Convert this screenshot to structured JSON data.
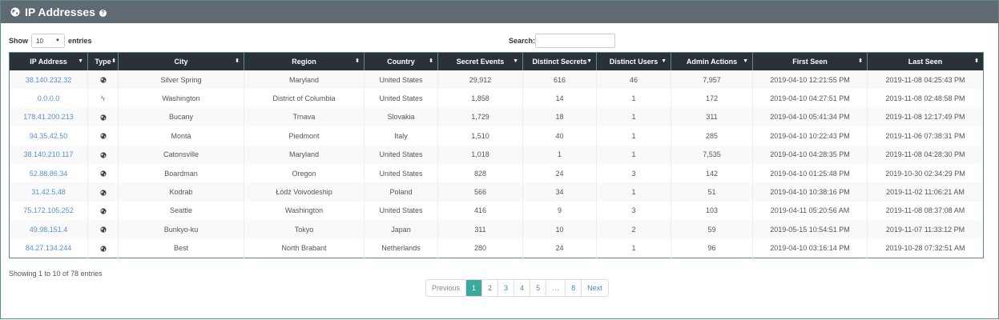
{
  "header": {
    "title": "IP Addresses",
    "help": "?"
  },
  "controls": {
    "show_label": "Show",
    "page_length": "10",
    "entries_label": "entries",
    "search_label": "Search:",
    "search_value": ""
  },
  "columns": [
    "IP Address",
    "Type",
    "City",
    "Region",
    "Country",
    "Secret Events",
    "Distinct Secrets",
    "Distinct Users",
    "Admin Actions",
    "First Seen",
    "Last Seen"
  ],
  "rows": [
    {
      "ip": "38.140.232.32",
      "type": "globe",
      "city": "Silver Spring",
      "region": "Maryland",
      "country": "United States",
      "secret_events": "29,912",
      "distinct_secrets": "616",
      "distinct_users": "46",
      "admin_actions": "7,957",
      "first_seen": "2019-04-10 12:21:55 PM",
      "last_seen": "2019-11-08 04:25:43 PM"
    },
    {
      "ip": "0.0.0.0",
      "type": "bolt",
      "city": "Washington",
      "region": "District of Columbia",
      "country": "United States",
      "secret_events": "1,858",
      "distinct_secrets": "14",
      "distinct_users": "1",
      "admin_actions": "172",
      "first_seen": "2019-04-10 04:27:51 PM",
      "last_seen": "2019-11-08 02:48:58 PM"
    },
    {
      "ip": "178.41.200.213",
      "type": "globe",
      "city": "Bucany",
      "region": "Trnava",
      "country": "Slovakia",
      "secret_events": "1,729",
      "distinct_secrets": "18",
      "distinct_users": "1",
      "admin_actions": "311",
      "first_seen": "2019-04-10 05:41:34 PM",
      "last_seen": "2019-11-08 12:17:49 PM"
    },
    {
      "ip": "94.35.42.50",
      "type": "globe",
      "city": "Montà",
      "region": "Piedmont",
      "country": "Italy",
      "secret_events": "1,510",
      "distinct_secrets": "40",
      "distinct_users": "1",
      "admin_actions": "285",
      "first_seen": "2019-04-10 10:22:43 PM",
      "last_seen": "2019-11-06 07:38:31 PM"
    },
    {
      "ip": "38.140.210.117",
      "type": "globe",
      "city": "Catonsville",
      "region": "Maryland",
      "country": "United States",
      "secret_events": "1,018",
      "distinct_secrets": "1",
      "distinct_users": "1",
      "admin_actions": "7,535",
      "first_seen": "2019-04-10 04:28:35 PM",
      "last_seen": "2019-11-08 04:28:30 PM"
    },
    {
      "ip": "52.88.86.34",
      "type": "globe",
      "city": "Boardman",
      "region": "Oregon",
      "country": "United States",
      "secret_events": "828",
      "distinct_secrets": "24",
      "distinct_users": "3",
      "admin_actions": "142",
      "first_seen": "2019-04-10 01:25:48 PM",
      "last_seen": "2019-10-30 02:34:29 PM"
    },
    {
      "ip": "31.42.5.48",
      "type": "globe",
      "city": "Kodrab",
      "region": "Łódź Voivodeship",
      "country": "Poland",
      "secret_events": "566",
      "distinct_secrets": "34",
      "distinct_users": "1",
      "admin_actions": "51",
      "first_seen": "2019-04-10 10:38:16 PM",
      "last_seen": "2019-11-02 11:06:21 AM"
    },
    {
      "ip": "75.172.105.252",
      "type": "globe",
      "city": "Seattle",
      "region": "Washington",
      "country": "United States",
      "secret_events": "416",
      "distinct_secrets": "9",
      "distinct_users": "3",
      "admin_actions": "103",
      "first_seen": "2019-04-11 05:20:56 AM",
      "last_seen": "2019-11-08 08:37:08 AM"
    },
    {
      "ip": "49.98.151.4",
      "type": "globe",
      "city": "Bunkyo-ku",
      "region": "Tokyo",
      "country": "Japan",
      "secret_events": "311",
      "distinct_secrets": "10",
      "distinct_users": "2",
      "admin_actions": "59",
      "first_seen": "2019-05-15 10:54:51 PM",
      "last_seen": "2019-11-07 11:33:12 PM"
    },
    {
      "ip": "84.27.134.244",
      "type": "globe",
      "city": "Best",
      "region": "North Brabant",
      "country": "Netherlands",
      "secret_events": "280",
      "distinct_secrets": "24",
      "distinct_users": "1",
      "admin_actions": "96",
      "first_seen": "2019-04-10 03:16:14 PM",
      "last_seen": "2019-10-28 07:32:51 AM"
    }
  ],
  "info": "Showing 1 to 10 of 78 entries",
  "pagination": {
    "previous": "Previous",
    "pages": [
      "1",
      "2",
      "3",
      "4",
      "5",
      "…",
      "8"
    ],
    "active": "1",
    "next": "Next"
  },
  "colors": {
    "header_bg": "#5f6a74",
    "table_head_bg": "#2a3138",
    "accent": "#3aa99f",
    "link": "#5a8fd3"
  }
}
